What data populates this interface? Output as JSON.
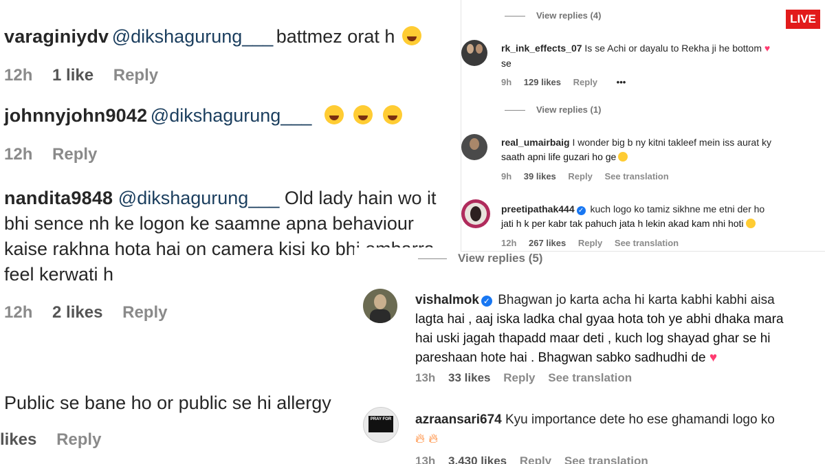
{
  "left": {
    "c1": {
      "user": "varaginiydv",
      "mention": "@dikshagurung___",
      "text": "battmez orat h",
      "time": "12h",
      "likes": "1 like",
      "reply": "Reply"
    },
    "c2": {
      "user": "johnnyjohn9042",
      "mention": "@dikshagurung___",
      "time": "12h",
      "reply": "Reply"
    },
    "c3": {
      "user": "nandita9848",
      "mention": "@dikshagurung___",
      "line1": "Old lady hain wo it",
      "line2": "bhi sence nh ke logon ke saamne apna behaviour",
      "line3": "kaise rakhna hota hai on camera kisi ko bhi embarra",
      "line4": "feel kerwati h",
      "time": "12h",
      "likes": "2 likes",
      "reply": "Reply"
    },
    "c4": {
      "text": "Public se bane ho or public se hi allergy",
      "likes": "likes",
      "reply": "Reply"
    }
  },
  "right_top": {
    "view1": "View replies (4)",
    "c1": {
      "user": "rk_ink_effects_07",
      "text": "Is se Achi or dayalu to Rekha ji he bottom",
      "text2": "se",
      "time": "9h",
      "likes": "129 likes",
      "reply": "Reply",
      "more": "•••"
    },
    "view2": "View replies (1)",
    "c2": {
      "user": "real_umairbaig",
      "text": "I wonder big b ny kitni takleef mein iss aurat ky",
      "text2": "saath apni life guzari ho ge",
      "time": "9h",
      "likes": "39 likes",
      "reply": "Reply",
      "translate": "See translation"
    },
    "c3": {
      "user": "preetipathak444",
      "text": "kuch logo ko tamiz sikhne me etni der ho",
      "text2": "jati h k per kabr tak pahuch jata h lekin akad kam nhi hoti",
      "time": "12h",
      "likes": "267 likes",
      "reply": "Reply",
      "translate": "See translation"
    }
  },
  "right_bottom": {
    "view": "View replies (5)",
    "c1": {
      "user": "vishalmok",
      "line1": "Bhagwan jo karta acha hi karta kabhi kabhi aisa",
      "line2": "lagta hai , aaj iska ladka chal gyaa hota toh ye abhi dhaka mara",
      "line3": "hai uski jagah thapadd maar deti , kuch log shayad ghar se hi",
      "line4": "pareshaan hote hai . Bhagwan sabko sadhudhi de",
      "time": "13h",
      "likes": "33 likes",
      "reply": "Reply",
      "translate": "See translation"
    },
    "c2": {
      "user": "azraansari674",
      "text": "Kyu importance dete ho ese ghamandi logo ko",
      "time": "13h",
      "likes": "3,430 likes",
      "reply": "Reply",
      "translate": "See translation",
      "avatar_text": "PRAY FOR"
    }
  },
  "badge": "LIVE",
  "colors": {
    "mention": "#1b3e5e",
    "meta": "#8a8a8a",
    "verified": "#1877f2",
    "live": "#e21b1b",
    "heart": "#ff3b70"
  }
}
